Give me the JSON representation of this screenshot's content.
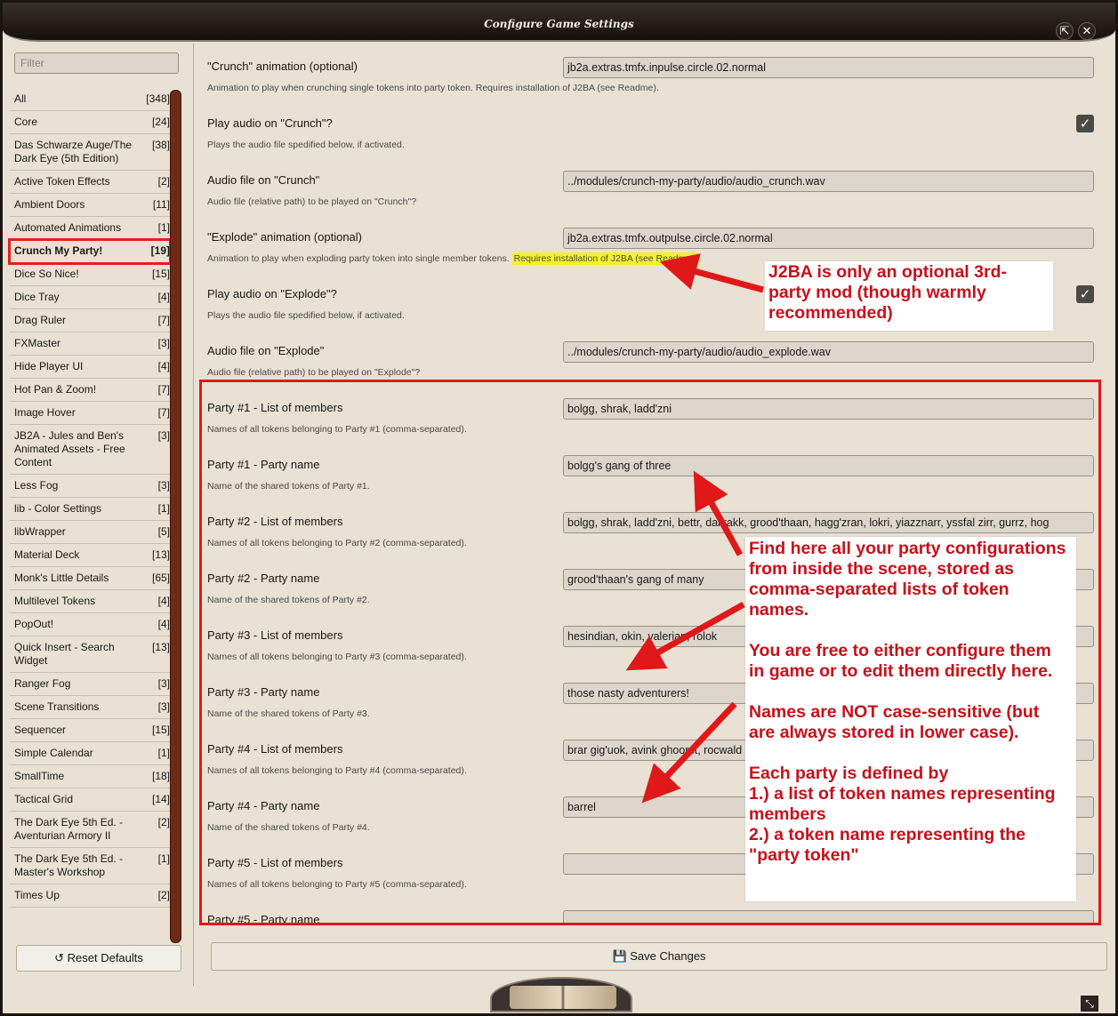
{
  "window": {
    "title": "Configure Game Settings",
    "popout_icon": "popout-icon",
    "close_icon": "close-icon"
  },
  "sidebar": {
    "filter_placeholder": "Filter",
    "categories": [
      {
        "label": "All",
        "count": "[348]"
      },
      {
        "label": "Core",
        "count": "[24]"
      },
      {
        "label": "Das Schwarze Auge/The Dark Eye (5th Edition)",
        "count": "[38]"
      },
      {
        "label": "Active Token Effects",
        "count": "[2]"
      },
      {
        "label": "Ambient Doors",
        "count": "[11]"
      },
      {
        "label": "Automated Animations",
        "count": "[1]"
      },
      {
        "label": "Crunch My Party!",
        "count": "[19]"
      },
      {
        "label": "Dice So Nice!",
        "count": "[15]"
      },
      {
        "label": "Dice Tray",
        "count": "[4]"
      },
      {
        "label": "Drag Ruler",
        "count": "[7]"
      },
      {
        "label": "FXMaster",
        "count": "[3]"
      },
      {
        "label": "Hide Player UI",
        "count": "[4]"
      },
      {
        "label": "Hot Pan & Zoom!",
        "count": "[7]"
      },
      {
        "label": "Image Hover",
        "count": "[7]"
      },
      {
        "label": "JB2A - Jules and Ben's Animated Assets - Free Content",
        "count": "[3]"
      },
      {
        "label": "Less Fog",
        "count": "[3]"
      },
      {
        "label": "lib - Color Settings",
        "count": "[1]"
      },
      {
        "label": "libWrapper",
        "count": "[5]"
      },
      {
        "label": "Material Deck",
        "count": "[13]"
      },
      {
        "label": "Monk's Little Details",
        "count": "[65]"
      },
      {
        "label": "Multilevel Tokens",
        "count": "[4]"
      },
      {
        "label": "PopOut!",
        "count": "[4]"
      },
      {
        "label": "Quick Insert - Search Widget",
        "count": "[13]"
      },
      {
        "label": "Ranger Fog",
        "count": "[3]"
      },
      {
        "label": "Scene Transitions",
        "count": "[3]"
      },
      {
        "label": "Sequencer",
        "count": "[15]"
      },
      {
        "label": "Simple Calendar",
        "count": "[1]"
      },
      {
        "label": "SmallTime",
        "count": "[18]"
      },
      {
        "label": "Tactical Grid",
        "count": "[14]"
      },
      {
        "label": "The Dark Eye 5th Ed. - Aventurian Armory II",
        "count": "[2]"
      },
      {
        "label": "The Dark Eye 5th Ed. - Master's Workshop",
        "count": "[1]"
      },
      {
        "label": "Times Up",
        "count": "[2]"
      }
    ],
    "active_category": "Crunch My Party!",
    "reset_label": "Reset Defaults"
  },
  "settings": [
    {
      "label": "\"Crunch\" animation (optional)",
      "hint": "Animation to play when crunching single tokens into party token. Requires installation of J2BA (see Readme).",
      "value": "jb2a.extras.tmfx.inpulse.circle.02.normal"
    },
    {
      "label": "Play audio on \"Crunch\"?",
      "hint": "Plays the audio file spedified below, if activated.",
      "checked": true
    },
    {
      "label": "Audio file on \"Crunch\"",
      "hint": "Audio file (relative path) to be played on \"Crunch\"?",
      "value": "../modules/crunch-my-party/audio/audio_crunch.wav"
    },
    {
      "label": "\"Explode\" animation (optional)",
      "hint": "Animation to play when exploding party token into single member tokens.",
      "hint_highlight": "Requires installation of J2BA (see Readme).",
      "value": "jb2a.extras.tmfx.outpulse.circle.02.normal"
    },
    {
      "label": "Play audio on \"Explode\"?",
      "hint": "Plays the audio file spedified below, if activated.",
      "checked": true
    },
    {
      "label": "Audio file on \"Explode\"",
      "hint": "Audio file (relative path) to be played on \"Explode\"?",
      "value": "../modules/crunch-my-party/audio/audio_explode.wav"
    },
    {
      "label": "Party #1 - List of members",
      "hint": "Names of all tokens belonging to Party #1 (comma-separated).",
      "value": "bolgg, shrak, ladd'zni"
    },
    {
      "label": "Party #1 - Party name",
      "hint": "Name of the shared tokens of Party #1.",
      "value": "bolgg's gang of three"
    },
    {
      "label": "Party #2 - List of members",
      "hint": "Names of all tokens belonging to Party #2 (comma-separated).",
      "value": "bolgg, shrak, ladd'zni, bettr, dallrakk, grood'thaan, hagg'zran, lokri, yiazznarr, yssfal zirr, gurrz, hog"
    },
    {
      "label": "Party #2 - Party name",
      "hint": "Name of the shared tokens of Party #2.",
      "value": "grood'thaan's gang of many"
    },
    {
      "label": "Party #3 - List of members",
      "hint": "Names of all tokens belonging to Party #3 (comma-separated).",
      "value": "hesindian, okin, valerian, rolok"
    },
    {
      "label": "Party #3 - Party name",
      "hint": "Name of the shared tokens of Party #3.",
      "value": "those nasty adventurers!"
    },
    {
      "label": "Party #4 - List of members",
      "hint": "Names of all tokens belonging to Party #4 (comma-separated).",
      "value": "brar gig'uok, avink ghoorst, rocwald                                                                                                                     en"
    },
    {
      "label": "Party #4 - Party name",
      "hint": "Name of the shared tokens of Party #4.",
      "value": "barrel"
    },
    {
      "label": "Party #5 - List of members",
      "hint": "Names of all tokens belonging to Party #5 (comma-separated).",
      "value": ""
    },
    {
      "label": "Party #5 - Party name",
      "hint": "",
      "value": ""
    }
  ],
  "footer": {
    "save_label": "Save Changes",
    "save_icon": "floppy-disk-icon"
  },
  "annotations": {
    "j2ba_note": "J2BA is only an optional 3rd-\nparty mod (though warmly\nrecommended)",
    "party_note": "Find here all your party configurations\nfrom inside the scene, stored as\ncomma-separated lists of token\nnames.\n\nYou are free to either configure them\nin game or to edit them directly here.\n\nNames are NOT case-sensitive (but\nare always stored in lower case).\n\nEach party is defined by\n1.) a list of token names representing\nmembers\n2.) a token name representing the\n\"party token\"",
    "color": "#e01818"
  }
}
